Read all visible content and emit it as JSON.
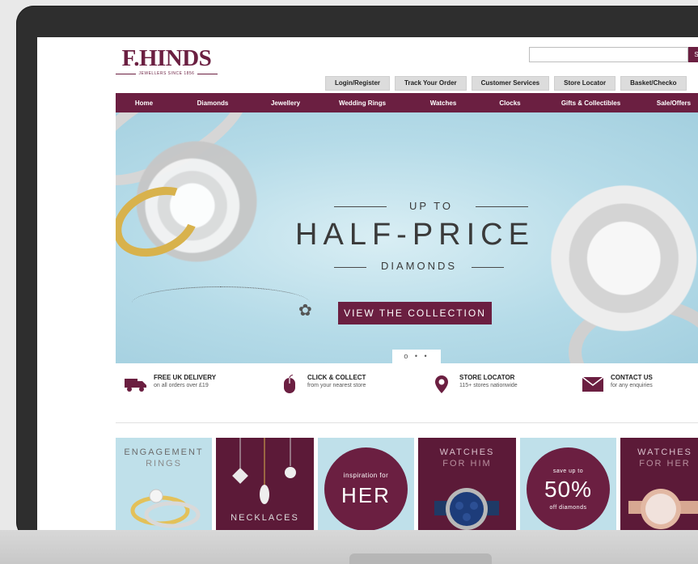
{
  "header": {
    "logo": "F.HINDS",
    "logo_sub": "JEWELLERS SINCE 1856",
    "search_button": "S",
    "util_links": [
      "Login/Register",
      "Track Your Order",
      "Customer Services",
      "Store Locator",
      "Basket/Checko"
    ]
  },
  "nav": [
    "Home",
    "Diamonds",
    "Jewellery",
    "Wedding Rings",
    "Watches",
    "Clocks",
    "Gifts & Collectibles",
    "Sale/Offers"
  ],
  "hero": {
    "up_to": "UP TO",
    "title": "HALF-PRICE",
    "subtitle": "DIAMONDS",
    "cta": "VIEW THE COLLECTION",
    "dots": "o • •"
  },
  "features": [
    {
      "title": "FREE UK DELIVERY",
      "sub": "on all orders over £19",
      "icon": "truck-icon"
    },
    {
      "title": "CLICK & COLLECT",
      "sub": "from your nearest store",
      "icon": "mouse-icon"
    },
    {
      "title": "STORE LOCATOR",
      "sub": "115+ stores nationwide",
      "icon": "map-pin-icon"
    },
    {
      "title": "CONTACT US",
      "sub": "for any enquiries",
      "icon": "envelope-icon"
    }
  ],
  "tiles": {
    "engagement": [
      "ENGAGEMENT",
      "RINGS"
    ],
    "necklaces": "NECKLACES",
    "her": [
      "inspiration for",
      "HER"
    ],
    "watches_him": [
      "WATCHES",
      "FOR HIM"
    ],
    "diamonds": [
      "save up to",
      "50%",
      "off diamonds"
    ],
    "watches_her": [
      "WATCHES",
      "FOR HER"
    ]
  },
  "colors": {
    "brand": "#6b1f41",
    "hero_bg": "#b5dbe8"
  }
}
